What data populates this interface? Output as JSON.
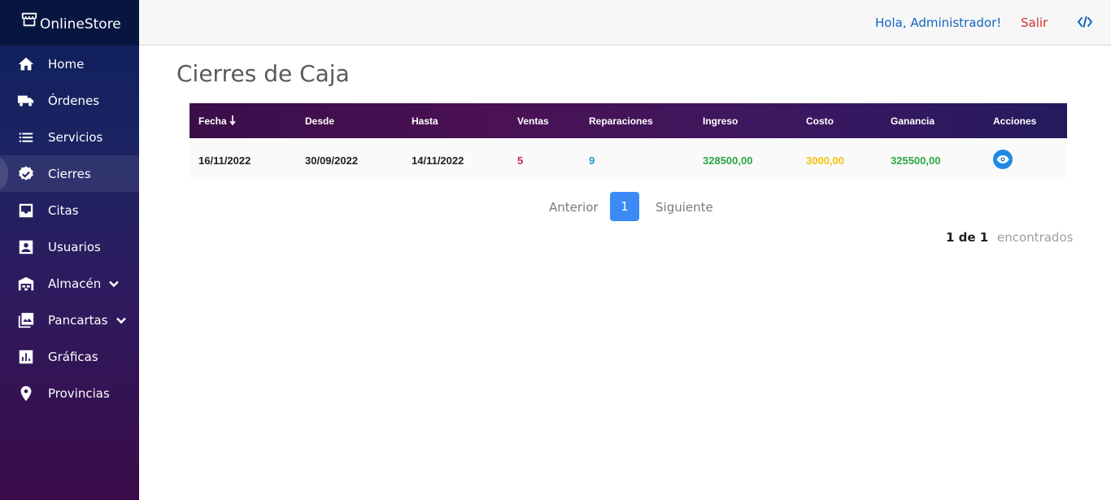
{
  "brand": {
    "name": "OnlineStore"
  },
  "sidebar": {
    "items": [
      {
        "label": "Home",
        "icon": "home-icon"
      },
      {
        "label": "Órdenes",
        "icon": "truck-icon"
      },
      {
        "label": "Servicios",
        "icon": "list-icon"
      },
      {
        "label": "Cierres",
        "icon": "verified-badge-icon",
        "active": true
      },
      {
        "label": "Citas",
        "icon": "inbox-icon"
      },
      {
        "label": "Usuarios",
        "icon": "user-card-icon"
      },
      {
        "label": "Almacén",
        "icon": "warehouse-icon",
        "expandable": true
      },
      {
        "label": "Pancartas",
        "icon": "photo-library-icon",
        "expandable": true
      },
      {
        "label": "Gráficas",
        "icon": "chart-box-icon"
      },
      {
        "label": "Provincias",
        "icon": "location-pin-icon"
      }
    ]
  },
  "topbar": {
    "greeting": "Hola, Administrador!",
    "logout": "Salir",
    "code_icon": "code-icon"
  },
  "page": {
    "title": "Cierres de Caja"
  },
  "table": {
    "columns": [
      "Fecha",
      "Desde",
      "Hasta",
      "Ventas",
      "Reparaciones",
      "Ingreso",
      "Costo",
      "Ganancia",
      "Acciones"
    ],
    "sort_icon": "arrow-down-icon",
    "rows": [
      {
        "fecha": "16/11/2022",
        "desde": "30/09/2022",
        "hasta": "14/11/2022",
        "ventas": "5",
        "reparaciones": "9",
        "ingreso": "328500,00",
        "costo": "3000,00",
        "ganancia": "325500,00",
        "action_icon": "eye-icon"
      }
    ]
  },
  "pagination": {
    "prev": "Anterior",
    "current": "1",
    "next": "Siguiente"
  },
  "result_count": {
    "value": "1 de 1",
    "label": "encontrados"
  },
  "colors": {
    "accent": "#1565c0",
    "danger": "#d32f2f",
    "pager_active": "#3b8af5",
    "ventas": "#c62848",
    "reparaciones": "#17a2b8",
    "positive": "#28a745",
    "costo": "#f4c20d"
  }
}
